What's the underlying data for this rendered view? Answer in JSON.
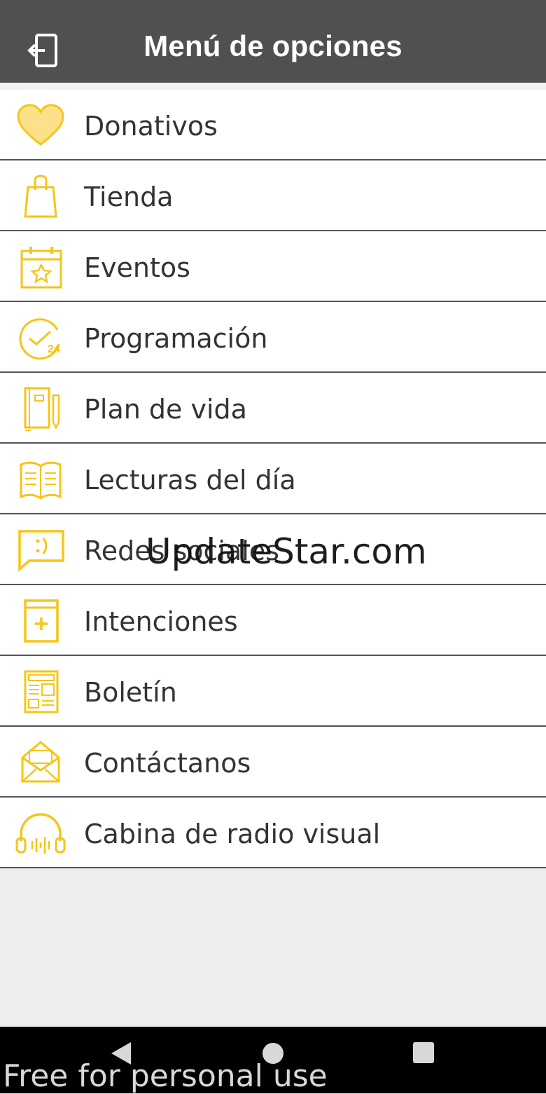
{
  "header": {
    "title": "Menú de opciones",
    "back_icon": "logout-icon"
  },
  "menu": [
    {
      "label": "Donativos",
      "icon": "heart-icon"
    },
    {
      "label": "Tienda",
      "icon": "shopping-bag-icon"
    },
    {
      "label": "Eventos",
      "icon": "calendar-star-icon"
    },
    {
      "label": "Programación",
      "icon": "clock-24-icon"
    },
    {
      "label": "Plan de vida",
      "icon": "notebook-pencil-icon"
    },
    {
      "label": "Lecturas del día",
      "icon": "open-book-icon"
    },
    {
      "label": "Redes sociales",
      "icon": "chat-smile-icon"
    },
    {
      "label": "Intenciones",
      "icon": "book-plus-icon"
    },
    {
      "label": "Boletín",
      "icon": "newsletter-icon"
    },
    {
      "label": "Contáctanos",
      "icon": "envelope-icon"
    },
    {
      "label": "Cabina de radio visual",
      "icon": "headphones-icon"
    }
  ],
  "watermark": "UpdateStar.com",
  "footer_watermark": "Free for personal use",
  "colors": {
    "header_bg": "#505050",
    "accent": "#f5c518",
    "background": "#ededed"
  }
}
